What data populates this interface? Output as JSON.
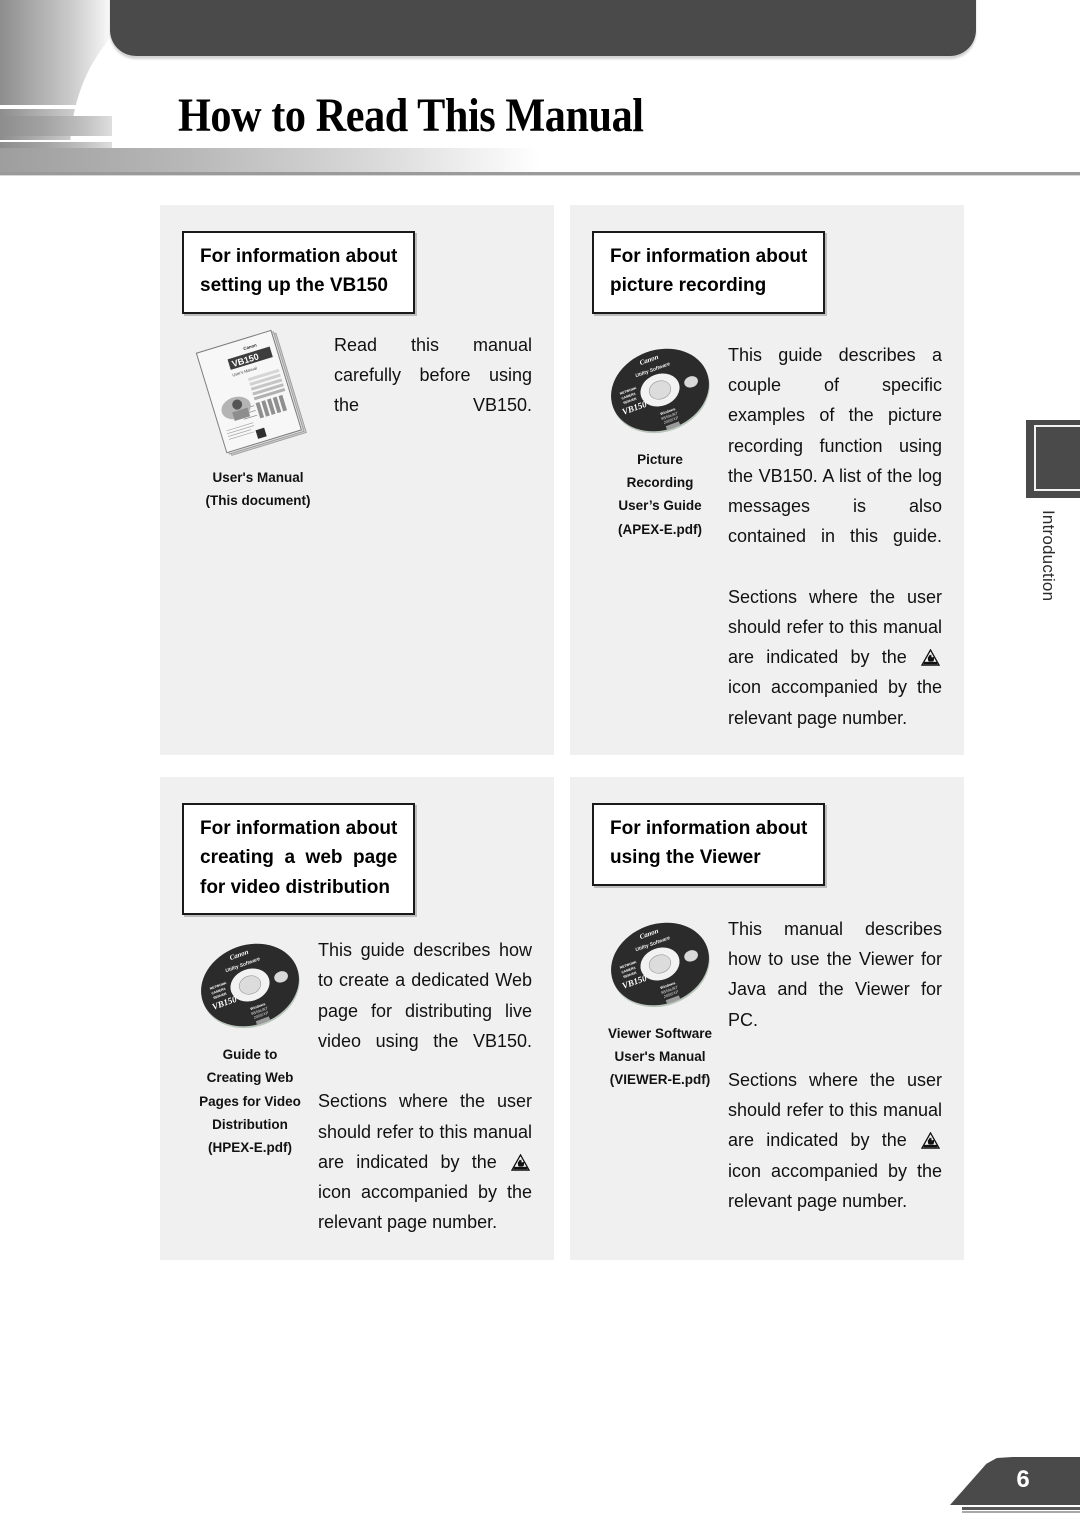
{
  "header": {
    "title": "How to Read This Manual"
  },
  "side_tab": {
    "label": "Introduction"
  },
  "cards": [
    {
      "heading_lines": [
        "For information about",
        "setting up the VB150"
      ],
      "media_icon": "booklet-icon",
      "caption_lines": [
        "User's Manual",
        "(This document)"
      ],
      "paragraphs": [
        "Read this manual carefully before using the VB150."
      ]
    },
    {
      "heading_lines": [
        "For information about",
        "picture recording"
      ],
      "media_icon": "cd-disc-icon",
      "caption_lines": [
        "Picture",
        "Recording",
        "User’s Guide",
        "(APEX-E.pdf)"
      ],
      "paragraphs": [
        "This guide describes a couple of specific examples of the picture recording function using the VB150. A list of the log messages is also contained in this guide.",
        "Sections where the user should refer to this manual are indicated by the",
        "icon accompanied by the relevant page number."
      ]
    },
    {
      "heading_lines": [
        "For information about",
        "creating a web page",
        "for video distribution"
      ],
      "media_icon": "cd-disc-icon",
      "caption_lines": [
        "Guide to",
        "Creating Web",
        "Pages for Video",
        "Distribution",
        "(HPEX-E.pdf)"
      ],
      "paragraphs": [
        "This guide describes how to create a dedicated Web page for distributing live video using the VB150.",
        "Sections where the user should refer to this manual are indicated by the",
        "icon accompanied by the relevant page number."
      ]
    },
    {
      "heading_lines": [
        "For information about",
        "using the Viewer"
      ],
      "media_icon": "cd-disc-icon",
      "caption_lines": [
        "Viewer Software",
        "User's Manual",
        "(VIEWER-E.pdf)"
      ],
      "paragraphs": [
        "This manual describes how to use the Viewer for Java and the Viewer for PC.",
        "Sections where the user should refer to this manual are indicated by the",
        "icon accompanied by the relevant page number."
      ]
    }
  ],
  "cd_label": {
    "brand": "Canon",
    "sub": "Utility Software",
    "product_lines": [
      "NETWORK",
      "CAMERA",
      "SERVER"
    ],
    "model": "VB150"
  },
  "footer": {
    "page_number": "6"
  },
  "colors": {
    "dark": "#4a4a4a",
    "panel": "#f0f0f0",
    "rule": "#9a9a9a"
  }
}
